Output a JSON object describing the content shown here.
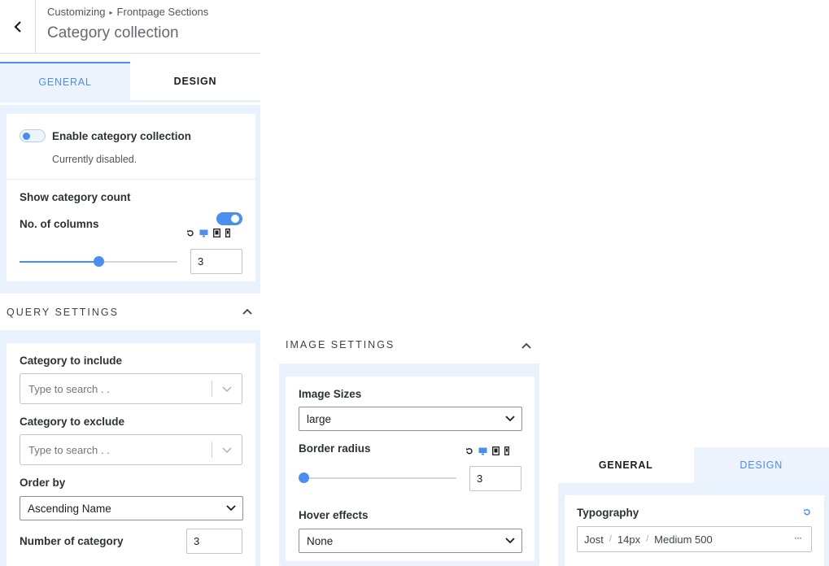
{
  "header": {
    "breadcrumb_root": "Customizing",
    "breadcrumb_sep": "▸",
    "breadcrumb_section": "Frontpage Sections",
    "title": "Category collection"
  },
  "tabs_left": {
    "general": "General",
    "design": "Design"
  },
  "enable": {
    "label": "Enable category collection",
    "status": "Currently disabled.",
    "enabled": false
  },
  "show_count": {
    "label": "Show category count",
    "enabled": true
  },
  "columns": {
    "label": "No. of columns",
    "value": "3",
    "slider_fraction": 0.5
  },
  "query": {
    "heading": "Query Settings",
    "include_label": "Category to include",
    "include_placeholder": "Type to search . .",
    "exclude_label": "Category to exclude",
    "exclude_placeholder": "Type to search . .",
    "order_label": "Order by",
    "order_value": "Ascending Name",
    "number_label": "Number of category",
    "number_value": "3"
  },
  "image": {
    "heading": "Image Settings",
    "sizes_label": "Image Sizes",
    "sizes_value": "large",
    "radius_label": "Border radius",
    "radius_value": "3",
    "radius_slider_fraction": 0.0,
    "hover_label": "Hover effects",
    "hover_value": "None"
  },
  "tabs_right": {
    "general": "General",
    "design": "Design"
  },
  "typography": {
    "label": "Typography",
    "font": "Jost",
    "size": "14px",
    "weight": "Medium 500",
    "sep": "/",
    "more": "···"
  },
  "colors": {
    "accent": "#4a8ef2",
    "frame": "#e9f1fd"
  }
}
